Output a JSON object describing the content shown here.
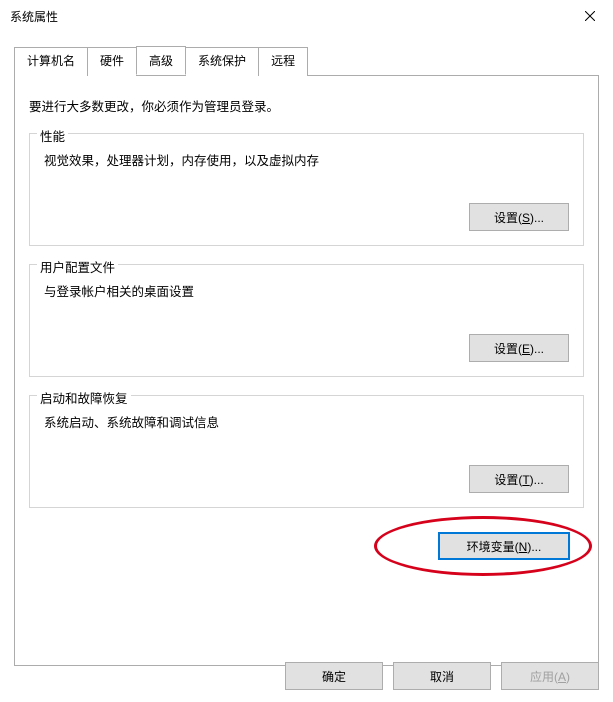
{
  "window": {
    "title": "系统属性"
  },
  "tabs": {
    "computer_name": "计算机名",
    "hardware": "硬件",
    "advanced": "高级",
    "system_protection": "系统保护",
    "remote": "远程"
  },
  "advanced_tab": {
    "intro": "要进行大多数更改，你必须作为管理员登录。",
    "performance": {
      "legend": "性能",
      "desc": "视觉效果，处理器计划，内存使用，以及虚拟内存",
      "button_prefix": "设置(",
      "button_key": "S",
      "button_suffix": ")..."
    },
    "user_profiles": {
      "legend": "用户配置文件",
      "desc": "与登录帐户相关的桌面设置",
      "button_prefix": "设置(",
      "button_key": "E",
      "button_suffix": ")..."
    },
    "startup_recovery": {
      "legend": "启动和故障恢复",
      "desc": "系统启动、系统故障和调试信息",
      "button_prefix": "设置(",
      "button_key": "T",
      "button_suffix": ")..."
    },
    "env_vars": {
      "button_prefix": "环境变量(",
      "button_key": "N",
      "button_suffix": ")..."
    }
  },
  "dialog_buttons": {
    "ok": "确定",
    "cancel": "取消",
    "apply_prefix": "应用(",
    "apply_key": "A",
    "apply_suffix": ")"
  }
}
